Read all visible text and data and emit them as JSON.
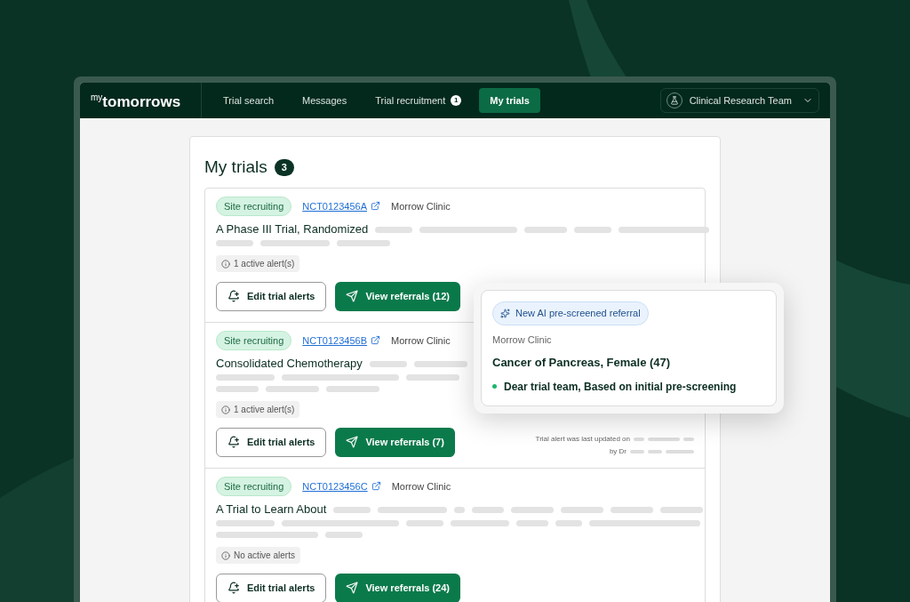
{
  "logo": {
    "prefix": "my",
    "name": "tomorrows"
  },
  "nav": [
    {
      "label": "Trial search",
      "selected": false
    },
    {
      "label": "Messages",
      "selected": false
    },
    {
      "label": "Trial recruitment",
      "selected": false,
      "badge": "1"
    },
    {
      "label": "My trials",
      "selected": true
    }
  ],
  "team_menu": {
    "label": "Clinical Research Team"
  },
  "page": {
    "title": "My trials",
    "count": "3"
  },
  "trials": [
    {
      "status": "Site recruiting",
      "id": "NCT0123456A",
      "site": "Morrow Clinic",
      "title": "A Phase III Trial, Randomized",
      "alert": "1 active alert(s)",
      "edit_button": "Edit trial alerts",
      "referrals_button": "View referrals (12)"
    },
    {
      "status": "Site recruiting",
      "id": "NCT0123456B",
      "site": "Morrow Clinic",
      "title": "Consolidated Chemotherapy",
      "alert": "1 active alert(s)",
      "edit_button": "Edit trial alerts",
      "referrals_button": "View referrals (7)",
      "updated": {
        "line_1": "Trial alert was last updated on",
        "line_2": "by Dr"
      }
    },
    {
      "status": "Site recruiting",
      "id": "NCT0123456C",
      "site": "Morrow Clinic",
      "title": "A Trial to Learn About",
      "alert": "No active alerts",
      "edit_button": "Edit trial alerts",
      "referrals_button": "View referrals (24)"
    }
  ],
  "popup": {
    "badge": "New AI pre-screened referral",
    "site": "Morrow Clinic",
    "title": "Cancer of Pancreas, Female (47)",
    "message": "Dear trial team, Based on initial pre-screening"
  }
}
